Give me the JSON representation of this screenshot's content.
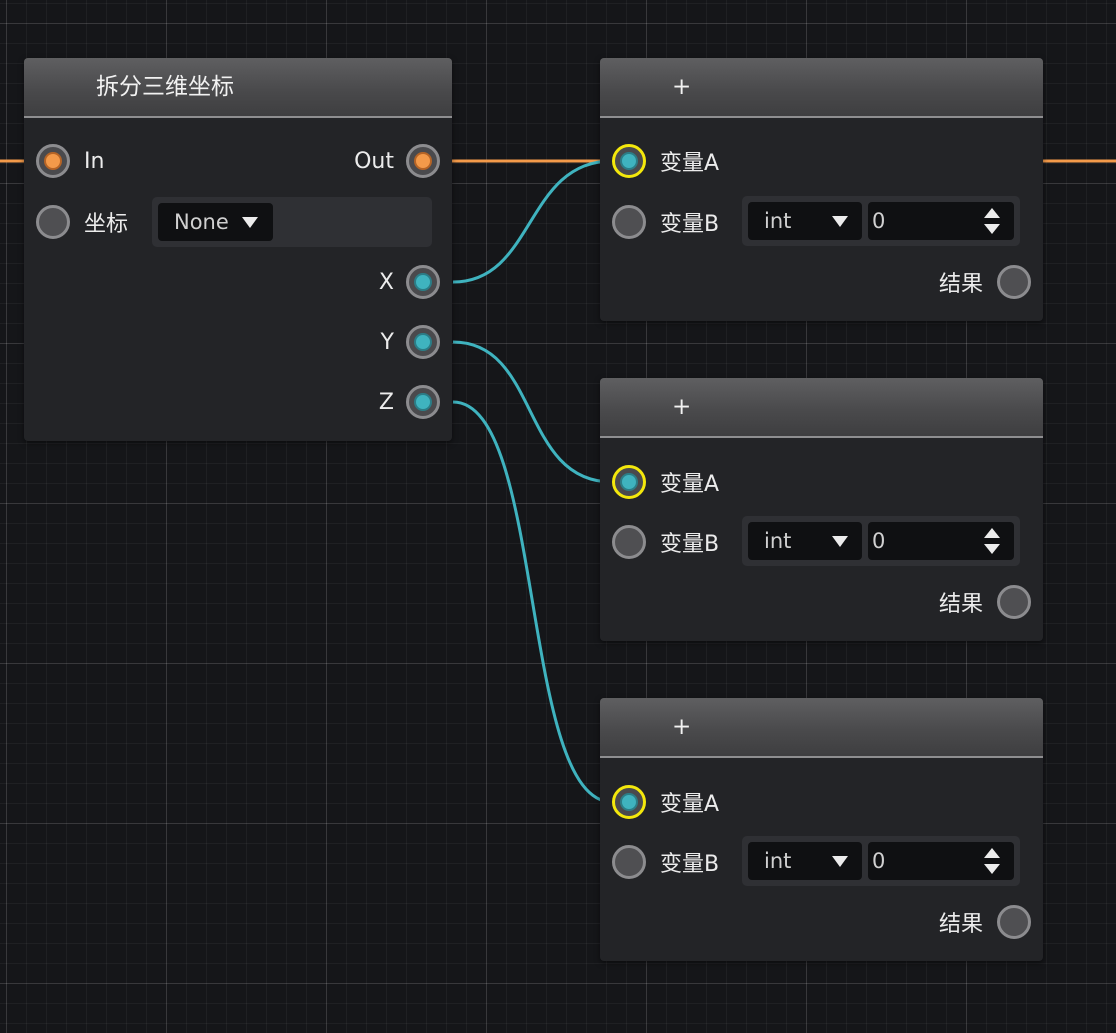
{
  "colors": {
    "exec_wire": "#f39a4a",
    "data_wire": "#3fb3bf",
    "selected_pin": "#f4e80c",
    "node_body": "#232427",
    "header_gradient": "#4a4a4c"
  },
  "split_node": {
    "title": "拆分三维坐标",
    "exec_in_label": "In",
    "exec_out_label": "Out",
    "coord_label": "坐标",
    "coord_value": "None",
    "outputs": [
      "X",
      "Y",
      "Z"
    ]
  },
  "add_nodes": [
    {
      "title": "+",
      "input_a": "变量A",
      "input_b": "变量B",
      "type_value": "int",
      "number_value": "0",
      "output": "结果"
    },
    {
      "title": "+",
      "input_a": "变量A",
      "input_b": "变量B",
      "type_value": "int",
      "number_value": "0",
      "output": "结果"
    },
    {
      "title": "+",
      "input_a": "变量A",
      "input_b": "变量B",
      "type_value": "int",
      "number_value": "0",
      "output": "结果"
    }
  ]
}
